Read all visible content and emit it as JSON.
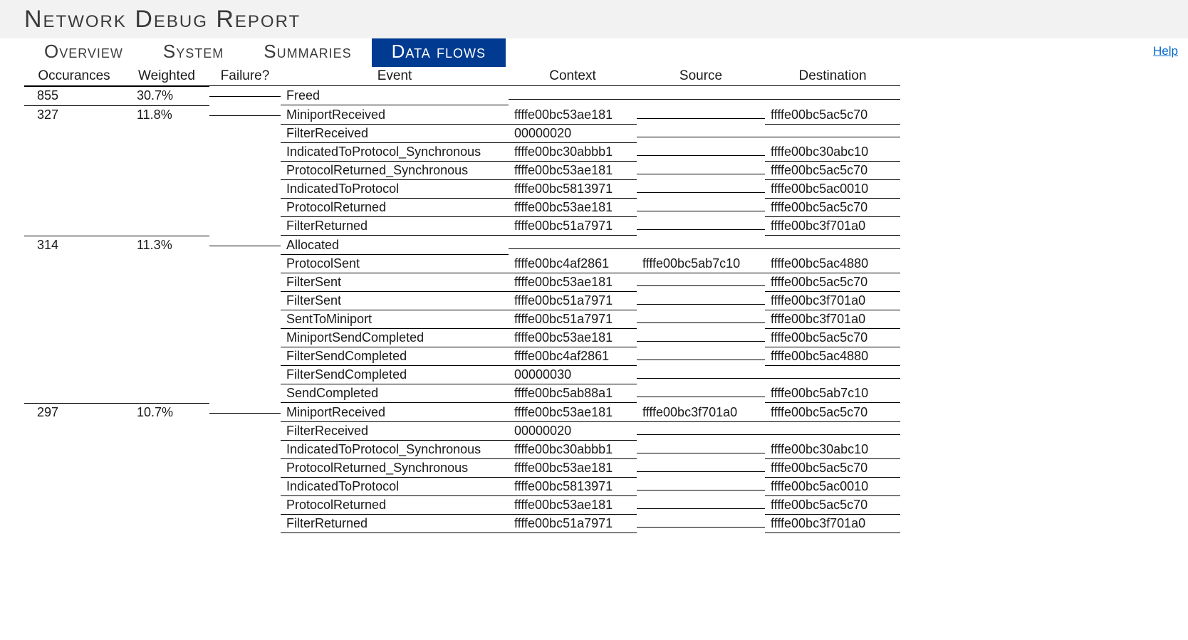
{
  "page_title": "Network Debug Report",
  "help_label": "Help",
  "tabs": [
    "Overview",
    "System",
    "Summaries",
    "Data flows"
  ],
  "active_tab": 3,
  "columns": [
    "Occurances",
    "Weighted",
    "Failure?",
    "Event",
    "Context",
    "Source",
    "Destination"
  ],
  "groups": [
    {
      "occurances": "855",
      "weighted": "30.7%",
      "failure": "",
      "rows": [
        {
          "event": "Freed",
          "context": "",
          "source": "",
          "destination": ""
        }
      ]
    },
    {
      "occurances": "327",
      "weighted": "11.8%",
      "failure": "",
      "rows": [
        {
          "event": "MiniportReceived",
          "context": "ffffe00bc53ae181",
          "source": "",
          "destination": "ffffe00bc5ac5c70"
        },
        {
          "event": "FilterReceived",
          "context": "00000020",
          "source": "",
          "destination": ""
        },
        {
          "event": "IndicatedToProtocol_Synchronous",
          "context": "ffffe00bc30abbb1",
          "source": "",
          "destination": "ffffe00bc30abc10"
        },
        {
          "event": "ProtocolReturned_Synchronous",
          "context": "ffffe00bc53ae181",
          "source": "",
          "destination": "ffffe00bc5ac5c70"
        },
        {
          "event": "IndicatedToProtocol",
          "context": "ffffe00bc5813971",
          "source": "",
          "destination": "ffffe00bc5ac0010"
        },
        {
          "event": "ProtocolReturned",
          "context": "ffffe00bc53ae181",
          "source": "",
          "destination": "ffffe00bc5ac5c70"
        },
        {
          "event": "FilterReturned",
          "context": "ffffe00bc51a7971",
          "source": "",
          "destination": "ffffe00bc3f701a0"
        }
      ]
    },
    {
      "occurances": "314",
      "weighted": "11.3%",
      "failure": "",
      "rows": [
        {
          "event": "Allocated",
          "context": "",
          "source": "",
          "destination": ""
        },
        {
          "event": "ProtocolSent",
          "context": "ffffe00bc4af2861",
          "source": "ffffe00bc5ab7c10",
          "destination": "ffffe00bc5ac4880"
        },
        {
          "event": "FilterSent",
          "context": "ffffe00bc53ae181",
          "source": "",
          "destination": "ffffe00bc5ac5c70"
        },
        {
          "event": "FilterSent",
          "context": "ffffe00bc51a7971",
          "source": "",
          "destination": "ffffe00bc3f701a0"
        },
        {
          "event": "SentToMiniport",
          "context": "ffffe00bc51a7971",
          "source": "",
          "destination": "ffffe00bc3f701a0"
        },
        {
          "event": "MiniportSendCompleted",
          "context": "ffffe00bc53ae181",
          "source": "",
          "destination": "ffffe00bc5ac5c70"
        },
        {
          "event": "FilterSendCompleted",
          "context": "ffffe00bc4af2861",
          "source": "",
          "destination": "ffffe00bc5ac4880"
        },
        {
          "event": "FilterSendCompleted",
          "context": "00000030",
          "source": "",
          "destination": ""
        },
        {
          "event": "SendCompleted",
          "context": "ffffe00bc5ab88a1",
          "source": "",
          "destination": "ffffe00bc5ab7c10"
        }
      ]
    },
    {
      "occurances": "297",
      "weighted": "10.7%",
      "failure": "",
      "rows": [
        {
          "event": "MiniportReceived",
          "context": "ffffe00bc53ae181",
          "source": "ffffe00bc3f701a0",
          "destination": "ffffe00bc5ac5c70"
        },
        {
          "event": "FilterReceived",
          "context": "00000020",
          "source": "",
          "destination": ""
        },
        {
          "event": "IndicatedToProtocol_Synchronous",
          "context": "ffffe00bc30abbb1",
          "source": "",
          "destination": "ffffe00bc30abc10"
        },
        {
          "event": "ProtocolReturned_Synchronous",
          "context": "ffffe00bc53ae181",
          "source": "",
          "destination": "ffffe00bc5ac5c70"
        },
        {
          "event": "IndicatedToProtocol",
          "context": "ffffe00bc5813971",
          "source": "",
          "destination": "ffffe00bc5ac0010"
        },
        {
          "event": "ProtocolReturned",
          "context": "ffffe00bc53ae181",
          "source": "",
          "destination": "ffffe00bc5ac5c70"
        },
        {
          "event": "FilterReturned",
          "context": "ffffe00bc51a7971",
          "source": "",
          "destination": "ffffe00bc3f701a0"
        }
      ]
    }
  ]
}
